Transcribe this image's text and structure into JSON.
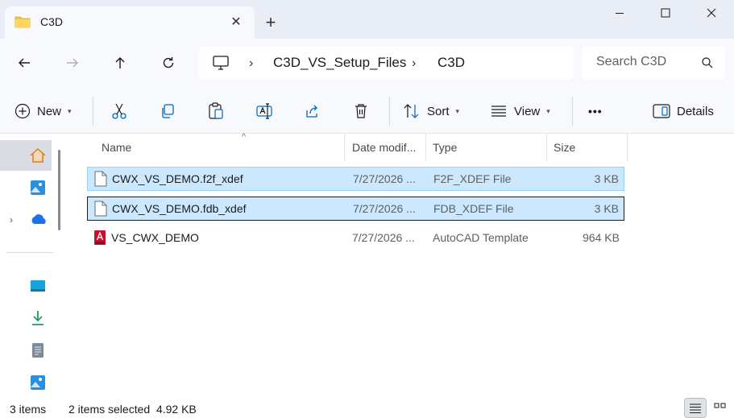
{
  "window": {
    "tab_title": "C3D",
    "new_tab_symbol": "+",
    "close_tab_symbol": "✕"
  },
  "nav": {
    "breadcrumbs": [
      "C3D_VS_Setup_Files",
      "C3D"
    ],
    "search_placeholder": "Search C3D"
  },
  "toolbar": {
    "new_label": "New",
    "sort_label": "Sort",
    "view_label": "View",
    "more_label": "•••",
    "details_label": "Details"
  },
  "columns": {
    "name": "Name",
    "date": "Date modif...",
    "type": "Type",
    "size": "Size"
  },
  "files": [
    {
      "name": "CWX_VS_DEMO.f2f_xdef",
      "date": "7/27/2026 ...",
      "type": "F2F_XDEF File",
      "size": "3 KB",
      "selected": true,
      "icon": "document-icon"
    },
    {
      "name": "CWX_VS_DEMO.fdb_xdef",
      "date": "7/27/2026 ...",
      "type": "FDB_XDEF File",
      "size": "3 KB",
      "selected": true,
      "icon": "document-icon"
    },
    {
      "name": "VS_CWX_DEMO",
      "date": "7/27/2026 ...",
      "type": "AutoCAD Template",
      "size": "964 KB",
      "selected": false,
      "icon": "autocad-template-icon"
    }
  ],
  "status": {
    "item_count": "3 items",
    "selection": "2 items selected  4.92 KB"
  },
  "colors": {
    "selection_bg": "#cce8ff",
    "selection_border": "#99d1ff",
    "chrome_bg": "#f7f9fc",
    "tabbar_bg": "#e9eef6",
    "folder_yellow": "#f4c542",
    "accent_blue": "#0067c0"
  }
}
